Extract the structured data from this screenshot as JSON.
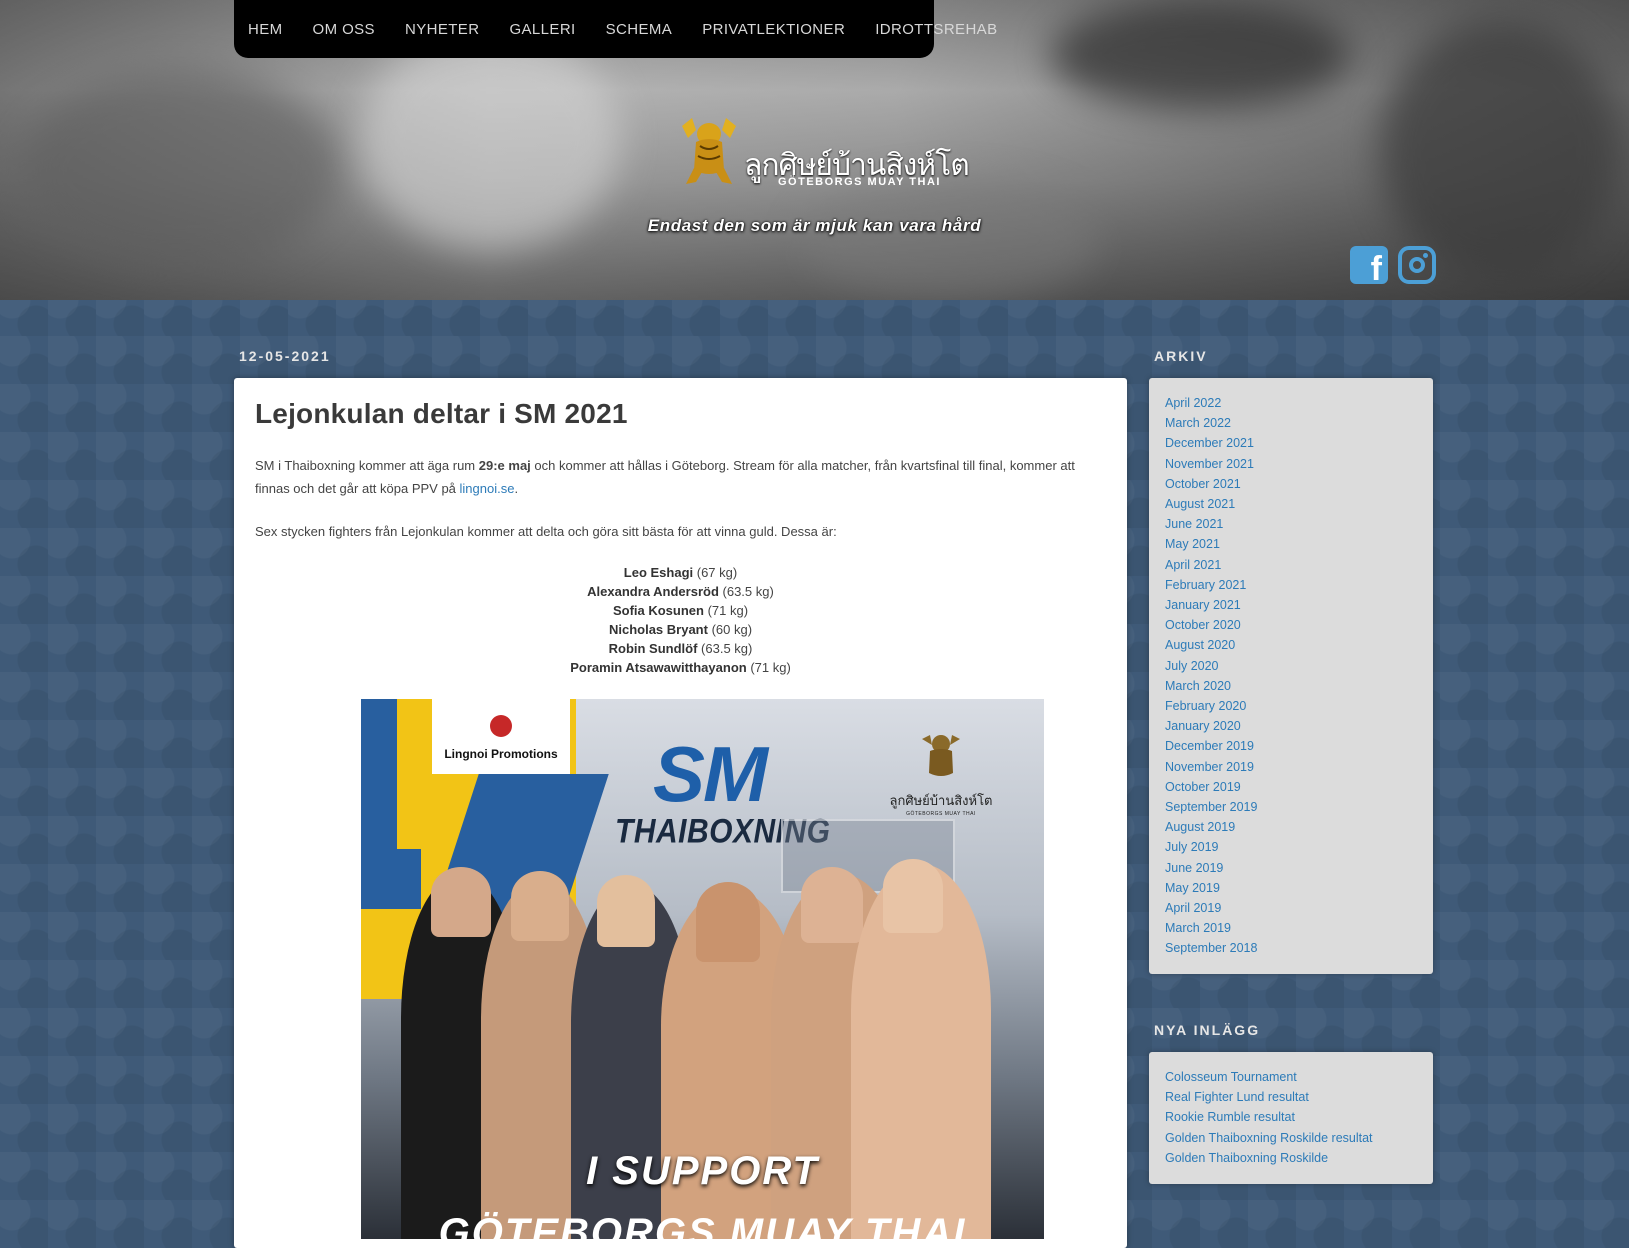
{
  "nav": [
    "HEM",
    "OM OSS",
    "NYHETER",
    "GALLERI",
    "SCHEMA",
    "PRIVATLEKTIONER",
    "IDROTTSREHAB"
  ],
  "header": {
    "logo_thai": "ลูกศิษย์บ้านสิงห์โต",
    "logo_sub": "GÖTEBORGS MUAY THAI",
    "tagline": "Endast den som är mjuk kan vara hård",
    "social": [
      "facebook-icon",
      "instagram-icon"
    ]
  },
  "post": {
    "date": "12-05-2021",
    "title": "Lejonkulan deltar i SM 2021",
    "p1_a": "SM i Thaiboxning kommer att äga rum ",
    "p1_bold": "29:e maj",
    "p1_b": " och kommer att hållas i Göteborg. Stream för alla matcher, från kvartsfinal till final, kommer att finnas och det går att köpa PPV på ",
    "p1_link": "lingnoi.se",
    "p1_c": ".",
    "p2": "Sex stycken fighters från Lejonkulan kommer att delta och göra sitt bästa för att vinna guld. Dessa är:",
    "fighters": [
      {
        "name": "Leo Eshagi",
        "weight": " (67 kg)"
      },
      {
        "name": "Alexandra Andersröd",
        "weight": " (63.5 kg)"
      },
      {
        "name": "Sofia Kosunen",
        "weight": " (71 kg)"
      },
      {
        "name": "Nicholas Bryant",
        "weight": " (60 kg)"
      },
      {
        "name": "Robin Sundlöf",
        "weight": " (63.5 kg)"
      },
      {
        "name": "Poramin Atsawawitthayanon",
        "weight": " (71 kg)"
      }
    ],
    "poster": {
      "promo": "Lingnoi Promotions",
      "title": "SM",
      "subtitle": "THAIBOXNING",
      "logo_thai": "ลูกศิษย์บ้านสิงห์โต",
      "logo_sub": "GÖTEBORGS MUAY THAI",
      "support": "I SUPPORT",
      "support2": "GÖTEBORGS MUAY THAI"
    }
  },
  "sidebar": {
    "archive_title": "ARKIV",
    "archive": [
      "April 2022",
      "March 2022",
      "December 2021",
      "November 2021",
      "October 2021",
      "August 2021",
      "June 2021",
      "May 2021",
      "April 2021",
      "February 2021",
      "January 2021",
      "October 2020",
      "August 2020",
      "July 2020",
      "March 2020",
      "February 2020",
      "January 2020",
      "December 2019",
      "November 2019",
      "October 2019",
      "September 2019",
      "August 2019",
      "July 2019",
      "June 2019",
      "May 2019",
      "April 2019",
      "March 2019",
      "September 2018"
    ],
    "recent_title": "NYA INLÄGG",
    "recent": [
      "Colosseum Tournament",
      "Real Fighter Lund resultat",
      "Rookie Rumble resultat",
      "Golden Thaiboxning Roskilde resultat",
      "Golden Thaiboxning Roskilde"
    ]
  },
  "colors": {
    "accent": "#2d7bb8",
    "background": "#3f5a78",
    "social": "#4c9fd6",
    "sm_blue": "#1e5fa9"
  }
}
